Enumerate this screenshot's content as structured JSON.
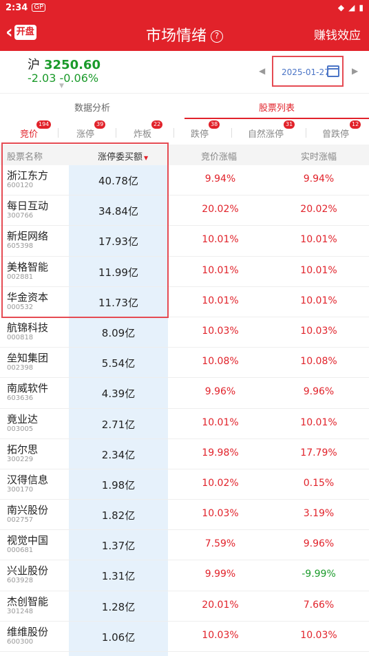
{
  "status": {
    "time": "2:34",
    "gp": "GP"
  },
  "header": {
    "back_badge": "开盘",
    "title": "市场情绪",
    "help": "?",
    "right": "赚钱效应"
  },
  "index": {
    "name": "沪",
    "price": "3250.60",
    "change": "-2.03",
    "pct": "-0.06%"
  },
  "date": {
    "value": "2025-01-27"
  },
  "segments": [
    "数据分析",
    "股票列表"
  ],
  "categories": [
    {
      "label": "竞价",
      "count": "194"
    },
    {
      "label": "涨停",
      "count": "39"
    },
    {
      "label": "炸板",
      "count": "22"
    },
    {
      "label": "跌停",
      "count": "38"
    },
    {
      "label": "自然涨停",
      "count": "31"
    },
    {
      "label": "曾跌停",
      "count": "12"
    }
  ],
  "table": {
    "headers": [
      "股票名称",
      "涨停委买额",
      "竞价涨幅",
      "实时涨幅"
    ],
    "rows": [
      {
        "name": "浙江东方",
        "code": "600120",
        "amount": "40.78亿",
        "bid": "9.94%",
        "rt": "9.94%"
      },
      {
        "name": "每日互动",
        "code": "300766",
        "amount": "34.84亿",
        "bid": "20.02%",
        "rt": "20.02%"
      },
      {
        "name": "新炬网络",
        "code": "605398",
        "amount": "17.93亿",
        "bid": "10.01%",
        "rt": "10.01%"
      },
      {
        "name": "美格智能",
        "code": "002881",
        "amount": "11.99亿",
        "bid": "10.01%",
        "rt": "10.01%"
      },
      {
        "name": "华金资本",
        "code": "000532",
        "amount": "11.73亿",
        "bid": "10.01%",
        "rt": "10.01%"
      },
      {
        "name": "航锦科技",
        "code": "000818",
        "amount": "8.09亿",
        "bid": "10.03%",
        "rt": "10.03%"
      },
      {
        "name": "垒知集团",
        "code": "002398",
        "amount": "5.54亿",
        "bid": "10.08%",
        "rt": "10.08%"
      },
      {
        "name": "南威软件",
        "code": "603636",
        "amount": "4.39亿",
        "bid": "9.96%",
        "rt": "9.96%"
      },
      {
        "name": "竟业达",
        "code": "003005",
        "amount": "2.71亿",
        "bid": "10.01%",
        "rt": "10.01%"
      },
      {
        "name": "拓尔思",
        "code": "300229",
        "amount": "2.34亿",
        "bid": "19.98%",
        "rt": "17.79%"
      },
      {
        "name": "汉得信息",
        "code": "300170",
        "amount": "1.98亿",
        "bid": "10.02%",
        "rt": "0.15%"
      },
      {
        "name": "南兴股份",
        "code": "002757",
        "amount": "1.82亿",
        "bid": "10.03%",
        "rt": "3.19%"
      },
      {
        "name": "视觉中国",
        "code": "000681",
        "amount": "1.37亿",
        "bid": "7.59%",
        "rt": "9.96%"
      },
      {
        "name": "兴业股份",
        "code": "603928",
        "amount": "1.31亿",
        "bid": "9.99%",
        "rt": "-9.99%"
      },
      {
        "name": "杰创智能",
        "code": "301248",
        "amount": "1.28亿",
        "bid": "20.01%",
        "rt": "7.66%"
      },
      {
        "name": "维维股份",
        "code": "600300",
        "amount": "1.06亿",
        "bid": "10.03%",
        "rt": "10.03%"
      }
    ]
  },
  "colors": {
    "brand": "#e1222a",
    "up": "#e1222a",
    "down": "#1a9a2a",
    "highlight_col": "#e6f1fb"
  }
}
